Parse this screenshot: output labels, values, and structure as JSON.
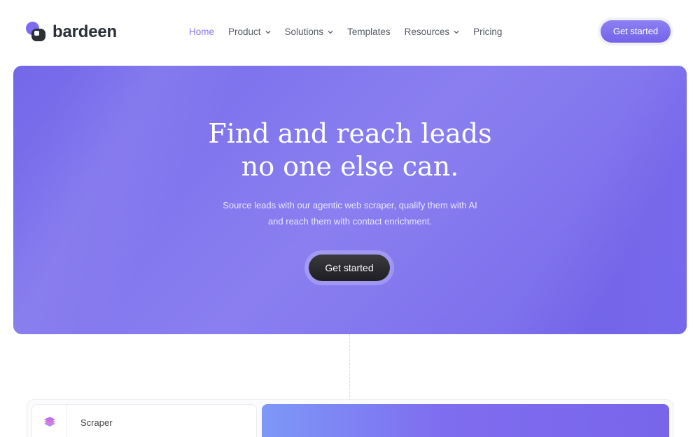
{
  "brand": {
    "name": "bardeen"
  },
  "nav": {
    "items": [
      {
        "label": "Home",
        "active": true
      },
      {
        "label": "Product",
        "dropdown": true
      },
      {
        "label": "Solutions",
        "dropdown": true
      },
      {
        "label": "Templates"
      },
      {
        "label": "Resources",
        "dropdown": true
      },
      {
        "label": "Pricing"
      }
    ],
    "cta": "Get started"
  },
  "hero": {
    "title_line1": "Find and reach leads",
    "title_line2": "no one else can.",
    "subtitle_line1": "Source leads with our agentic web scraper, qualify them with AI",
    "subtitle_line2": "and reach them with contact enrichment.",
    "cta": "Get started"
  },
  "panel": {
    "first_item": {
      "label": "Scraper",
      "icon": "layers-icon"
    }
  },
  "colors": {
    "accent": "#7b6cf0",
    "hero_bg": "#7f73ed",
    "dark_button": "#2a2a2e"
  }
}
